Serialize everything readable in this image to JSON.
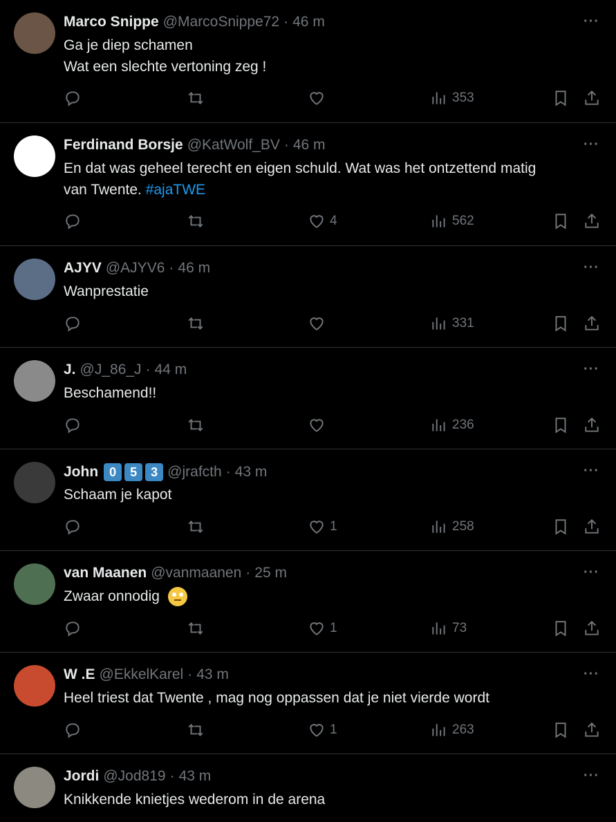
{
  "tweets": [
    {
      "name": "Marco Snippe",
      "handle": "@MarcoSnippe72",
      "time": "46 m",
      "lines": [
        "Ga je diep schamen",
        "Wat een slechte vertoning zeg !"
      ],
      "likes": "",
      "views": "353",
      "avatar_color": "#6b5546"
    },
    {
      "name": "Ferdinand Borsje",
      "handle": "@KatWolf_BV",
      "time": "46 m",
      "lines": [
        "En dat was geheel terecht en eigen schuld. Wat was het ontzettend matig",
        "van Twente. "
      ],
      "hashtag": "#ajaTWE",
      "likes": "4",
      "views": "562",
      "avatar_color": "#ffffff"
    },
    {
      "name": "AJYV",
      "handle": "@AJYV6",
      "time": "46 m",
      "lines": [
        "Wanprestatie"
      ],
      "likes": "",
      "views": "331",
      "avatar_color": "#5c6e86"
    },
    {
      "name": "J.",
      "handle": "@J_86_J",
      "time": "44 m",
      "lines": [
        "Beschamend!!"
      ],
      "likes": "",
      "views": "236",
      "avatar_color": "#8a8a8a"
    },
    {
      "name": "John",
      "handle": "@jrafcth",
      "time": "43 m",
      "badges": [
        "0",
        "5",
        "3"
      ],
      "lines": [
        "Schaam je kapot"
      ],
      "likes": "1",
      "views": "258",
      "avatar_color": "#3a3a3a"
    },
    {
      "name": "van Maanen",
      "handle": "@vanmaanen",
      "time": "25 m",
      "lines": [
        "Zwaar onnodig "
      ],
      "emoji": "face-with-rolling-eyes",
      "likes": "1",
      "views": "73",
      "avatar_color": "#4f6f52"
    },
    {
      "name": "W .E",
      "handle": "@EkkelKarel",
      "time": "43 m",
      "lines": [
        "Heel triest dat Twente  , mag nog oppassen dat je niet vierde wordt"
      ],
      "likes": "1",
      "views": "263",
      "avatar_color": "#c84b2f"
    },
    {
      "name": "Jordi",
      "handle": "@Jod819",
      "time": "43 m",
      "lines": [
        "Knikkende knietjes wederom in de arena"
      ],
      "likes": "",
      "views": "",
      "avatar_color": "#8c8a80"
    }
  ],
  "icons": {
    "reply": "reply-icon",
    "retweet": "retweet-icon",
    "like": "heart-icon",
    "views": "views-icon",
    "bookmark": "bookmark-icon",
    "share": "share-icon",
    "more": "more-icon"
  },
  "more_label": "···",
  "dot": "·"
}
